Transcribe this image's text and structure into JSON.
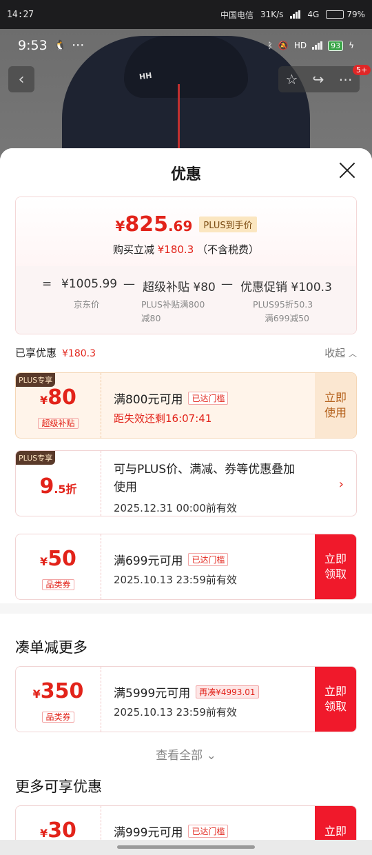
{
  "outer_status": {
    "time": "14:27",
    "carrier": "中国电信",
    "speed": "31K/s",
    "network": "4G",
    "battery_pct": "79%",
    "battery_level": 0.79
  },
  "inner_status": {
    "time": "9:53",
    "dots": "···",
    "battery": "93"
  },
  "product": {
    "logo_text": "HH",
    "cart_badge": "5+"
  },
  "sheet": {
    "title": "优惠"
  },
  "summary": {
    "price_sym": "¥",
    "price_int": "825",
    "price_dec": ".69",
    "plus_tag": "PLUS到手价",
    "reduce_prefix": "购买立减",
    "reduce_amount": "¥180.3",
    "reduce_suffix": "（不含税费）",
    "calc": [
      {
        "op": "=",
        "value": "¥1005.99",
        "sub1": "京东价",
        "sub2": ""
      },
      {
        "op": "—",
        "value": "超级补贴 ¥80",
        "sub1": "PLUS补贴满800",
        "sub2": "减80"
      },
      {
        "op": "—",
        "value": "优惠促销 ¥100.3",
        "sub1": "PLUS95折50.3",
        "sub2": "满699减50"
      }
    ]
  },
  "enjoyed": {
    "label": "已享优惠",
    "amount": "¥180.3",
    "collapse": "收起"
  },
  "coupons": [
    {
      "badge": "PLUS专享",
      "sym": "¥",
      "num": "80",
      "type": "超级补贴",
      "cond": "满800元可用",
      "tag": "已达门槛",
      "sub": "距失效还剩16:07:41",
      "cta1": "立即",
      "cta2": "使用"
    },
    {
      "badge": "PLUS专享",
      "num": "9",
      "dec": ".5折",
      "cond": "可与PLUS价、满减、券等优惠叠加",
      "cond2": "使用",
      "sub": "2025.12.31 00:00前有效",
      "arrow": "›"
    },
    {
      "sym": "¥",
      "num": "50",
      "type": "品类券",
      "cond": "满699元可用",
      "tag": "已达门槛",
      "sub": "2025.10.13 23:59前有效",
      "cta1": "立即",
      "cta2": "领取"
    }
  ],
  "more_section": {
    "title": "凑单减更多",
    "coupon": {
      "sym": "¥",
      "num": "350",
      "type": "品类券",
      "cond": "满5999元可用",
      "tag": "再凑¥4993.01",
      "sub": "2025.10.13 23:59前有效",
      "cta1": "立即",
      "cta2": "领取"
    },
    "see_all": "查看全部 ⌄"
  },
  "extra_section": {
    "title": "更多可享优惠",
    "coupon": {
      "sym": "¥",
      "num": "30",
      "cond": "满999元可用",
      "tag": "已达门槛",
      "cta1": "立即"
    }
  },
  "colors": {
    "accent": "#e2231a",
    "cta": "#f0192b",
    "plus_gold": "#fbe6c0"
  }
}
